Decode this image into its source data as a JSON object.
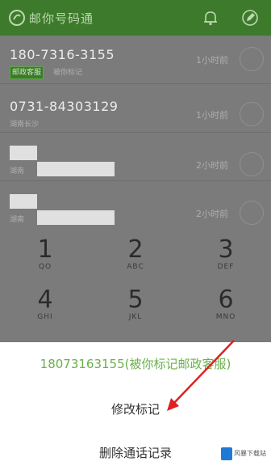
{
  "header": {
    "title": "邮你号码通"
  },
  "calls": [
    {
      "number": "180-7316-3155",
      "tag": "邮政客服",
      "sub": "被你标记",
      "time": "1小时前"
    },
    {
      "number": "0731-84303129",
      "sub": "湖南长沙",
      "time": "1小时前"
    },
    {
      "sub": "湖南",
      "time": "2小时前"
    },
    {
      "sub": "湖南",
      "time": "2小时前"
    }
  ],
  "dialpad": {
    "keys": [
      {
        "digit": "1",
        "letters": "QO"
      },
      {
        "digit": "2",
        "letters": "ABC"
      },
      {
        "digit": "3",
        "letters": "DEF"
      },
      {
        "digit": "4",
        "letters": "GHI"
      },
      {
        "digit": "5",
        "letters": "JKL"
      },
      {
        "digit": "6",
        "letters": "MNO"
      }
    ]
  },
  "sheet": {
    "title": "18073163155(被你标记邮政客服)",
    "items": [
      "修改标记",
      "删除通话记录"
    ]
  },
  "watermark": {
    "text": "风暴下载站"
  },
  "colors": {
    "header_bg": "#3d7a2b",
    "sheet_title": "#6ab04c",
    "arrow": "#e02020"
  }
}
